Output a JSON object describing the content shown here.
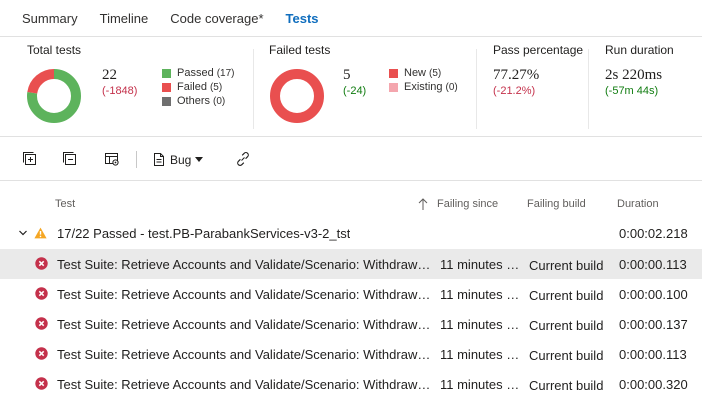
{
  "tabs": [
    {
      "label": "Summary",
      "active": false
    },
    {
      "label": "Timeline",
      "active": false
    },
    {
      "label": "Code coverage*",
      "active": false
    },
    {
      "label": "Tests",
      "active": true
    }
  ],
  "summary": {
    "total": {
      "title": "Total tests",
      "value": "22",
      "delta": "(-1848)",
      "legend": [
        {
          "label": "Passed",
          "count": "(17)",
          "color": "#5db35c"
        },
        {
          "label": "Failed",
          "count": "(5)",
          "color": "#e94f4f"
        },
        {
          "label": "Others",
          "count": "(0)",
          "color": "#6f6f6f"
        }
      ],
      "donut_fractions": [
        0.7727,
        0.2273
      ]
    },
    "failed": {
      "title": "Failed tests",
      "value": "5",
      "delta": "(-24)",
      "legend": [
        {
          "label": "New",
          "count": "(5)",
          "color": "#e94f4f"
        },
        {
          "label": "Existing",
          "count": "(0)",
          "color": "#f4a6ae"
        }
      ],
      "donut_fractions": [
        1.0,
        0.0
      ]
    },
    "pass_pct": {
      "title": "Pass percentage",
      "value": "77.27%",
      "delta": "(-21.2%)"
    },
    "duration": {
      "title": "Run duration",
      "value": "2s 220ms",
      "delta": "(-57m 44s)"
    }
  },
  "toolbar": {
    "bug_label": "Bug",
    "icons": [
      "expand-all-icon",
      "collapse-all-icon",
      "column-options-icon",
      "bug-icon",
      "link-icon"
    ]
  },
  "columns": {
    "test": "Test",
    "failing_since": "Failing since",
    "failing_build": "Failing build",
    "duration": "Duration"
  },
  "group": {
    "label": "17/22 Passed - test.PB-ParabankServices-v3-2_tst",
    "duration": "0:00:02.218"
  },
  "rows": [
    {
      "name": "Test Suite: Retrieve Accounts and Validate/Scenario: Withdraw…",
      "failing_since": "11 minutes …",
      "failing_build": "Current build",
      "duration": "0:00:00.113"
    },
    {
      "name": "Test Suite: Retrieve Accounts and Validate/Scenario: Withdraw…",
      "failing_since": "11 minutes …",
      "failing_build": "Current build",
      "duration": "0:00:00.100"
    },
    {
      "name": "Test Suite: Retrieve Accounts and Validate/Scenario: Withdraw…",
      "failing_since": "11 minutes …",
      "failing_build": "Current build",
      "duration": "0:00:00.137"
    },
    {
      "name": "Test Suite: Retrieve Accounts and Validate/Scenario: Withdraw…",
      "failing_since": "11 minutes …",
      "failing_build": "Current build",
      "duration": "0:00:00.113"
    },
    {
      "name": "Test Suite: Retrieve Accounts and Validate/Scenario: Withdraw…",
      "failing_since": "11 minutes …",
      "failing_build": "Current build",
      "duration": "0:00:00.320"
    }
  ]
}
